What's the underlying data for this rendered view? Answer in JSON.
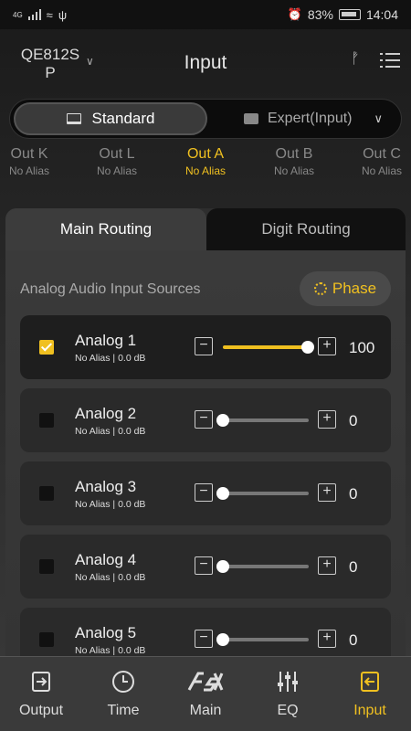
{
  "status": {
    "network": "4G",
    "battery": "83%",
    "time": "14:04"
  },
  "header": {
    "device": "QE812S P",
    "title": "Input"
  },
  "mode": {
    "standard": "Standard",
    "expert": "Expert(Input)"
  },
  "outputs": [
    {
      "name": "Out K",
      "alias": "No Alias"
    },
    {
      "name": "Out L",
      "alias": "No Alias"
    },
    {
      "name": "Out A",
      "alias": "No Alias",
      "active": true
    },
    {
      "name": "Out B",
      "alias": "No Alias"
    },
    {
      "name": "Out C",
      "alias": "No Alias"
    }
  ],
  "tabs": {
    "main": "Main Routing",
    "digit": "Digit Routing"
  },
  "section": {
    "label": "Analog Audio Input Sources",
    "phase": "Phase"
  },
  "inputs": [
    {
      "name": "Analog 1",
      "sub": "No Alias  |  0.0 dB",
      "value": "100",
      "checked": true
    },
    {
      "name": "Analog 2",
      "sub": "No Alias  |  0.0 dB",
      "value": "0",
      "checked": false
    },
    {
      "name": "Analog 3",
      "sub": "No Alias  |  0.0 dB",
      "value": "0",
      "checked": false
    },
    {
      "name": "Analog 4",
      "sub": "No Alias  |  0.0 dB",
      "value": "0",
      "checked": false
    },
    {
      "name": "Analog 5",
      "sub": "No Alias  |  0.0 dB",
      "value": "0",
      "checked": false
    }
  ],
  "nav": [
    "Output",
    "Time",
    "Main",
    "EQ",
    "Input"
  ],
  "colors": {
    "accent": "#f0c020"
  }
}
